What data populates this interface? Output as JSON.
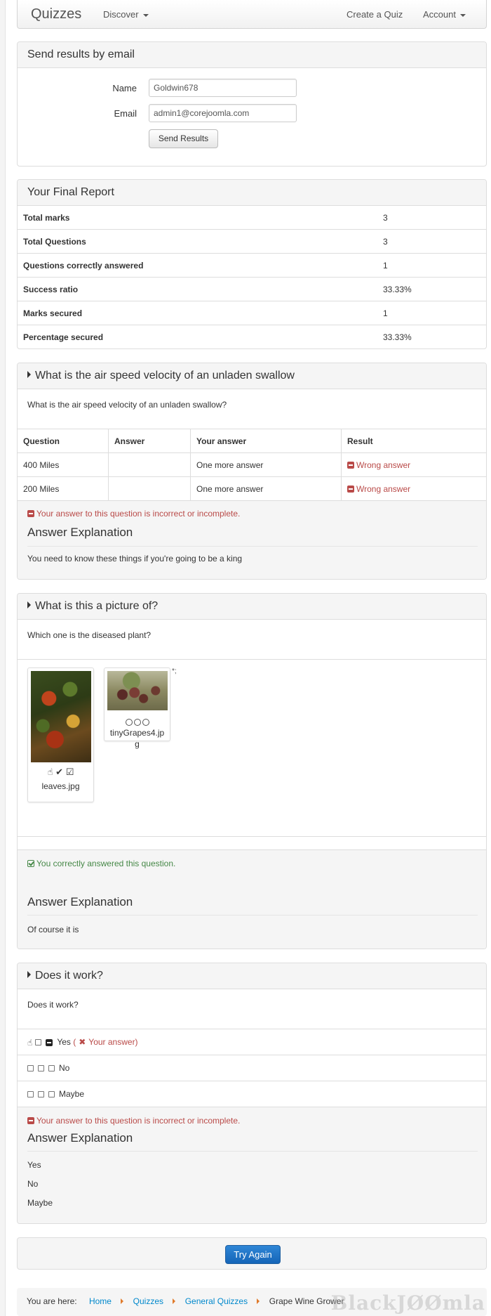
{
  "navbar": {
    "brand": "Quizzes",
    "discover": "Discover",
    "create_quiz": "Create a Quiz",
    "account": "Account"
  },
  "email_panel": {
    "title": "Send results by email",
    "name_label": "Name",
    "name_value": "Goldwin678",
    "email_label": "Email",
    "email_value": "admin1@corejoomla.com",
    "send_button": "Send Results"
  },
  "report": {
    "title": "Your Final Report",
    "rows": [
      {
        "label": "Total marks",
        "value": "3"
      },
      {
        "label": "Total Questions",
        "value": "3"
      },
      {
        "label": "Questions correctly answered",
        "value": "1"
      },
      {
        "label": "Success ratio",
        "value": "33.33%"
      },
      {
        "label": "Marks secured",
        "value": "1"
      },
      {
        "label": "Percentage secured",
        "value": "33.33%"
      }
    ]
  },
  "q1": {
    "title": "What is the air speed velocity of an unladen swallow",
    "question": "What is the air speed velocity of an unladen swallow?",
    "headers": [
      "Question",
      "Answer",
      "Your answer",
      "Result"
    ],
    "rows": [
      {
        "question": "400 Miles",
        "answer": "",
        "your_answer": "One more answer",
        "result": "Wrong answer"
      },
      {
        "question": "200 Miles",
        "answer": "",
        "your_answer": "One more answer",
        "result": "Wrong answer"
      }
    ],
    "status": "Your answer to this question is incorrect or incomplete.",
    "explanation_title": "Answer Explanation",
    "explanation": "You need to know these things if you're going to be a king"
  },
  "q2": {
    "title": "What is this a picture of?",
    "question": "Which one is the diseased plant?",
    "images": [
      {
        "label": "leaves.jpg"
      },
      {
        "label_line1": "tinyGrapes4.jp",
        "label_line2": "g"
      }
    ],
    "stray_mark": "*;",
    "status": "You correctly answered this question.",
    "explanation_title": "Answer Explanation",
    "explanation": "Of course it is"
  },
  "q3": {
    "title": "Does it work?",
    "question": "Does it work?",
    "options": [
      {
        "label": "Yes",
        "note_open": "(",
        "note": "Your answer)"
      },
      {
        "label": "No"
      },
      {
        "label": "Maybe"
      }
    ],
    "status": "Your answer to this question is incorrect or incomplete.",
    "explanation_title": "Answer Explanation",
    "explanation_lines": [
      "Yes",
      "No",
      "Maybe"
    ]
  },
  "try_again": "Try Again",
  "breadcrumb": {
    "prefix": "You are here:",
    "items": [
      "Home",
      "Quizzes",
      "General Quizzes"
    ],
    "current": "Grape Wine Grower",
    "watermark": "BlackJØØmla"
  },
  "colors": {
    "error": "#b94a48",
    "success": "#468847",
    "primary": "#1565b8",
    "link": "#0088cc"
  }
}
